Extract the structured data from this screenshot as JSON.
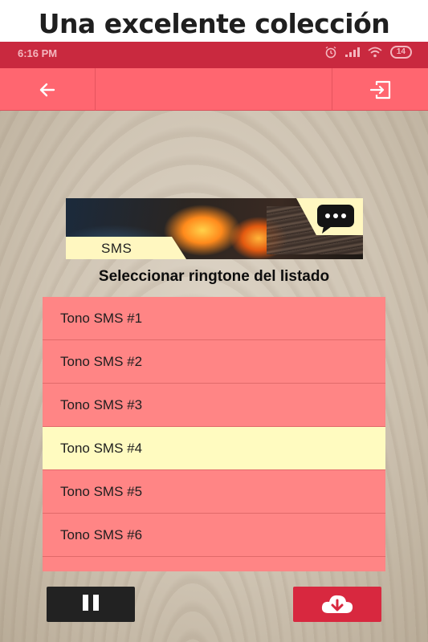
{
  "promo_title": "Una excelente colección",
  "status_bar": {
    "time": "6:16 PM",
    "battery": "14",
    "icons": [
      "alarm-icon",
      "signal-icon",
      "wifi-icon",
      "battery-icon"
    ]
  },
  "app_bar": {
    "back_icon": "arrow-left-icon",
    "exit_icon": "exit-icon"
  },
  "banner": {
    "label": "SMS",
    "icon": "chat-bubble-icon"
  },
  "heading": "Seleccionar ringtone del listado",
  "ringtones": [
    {
      "label": "Tono SMS #1"
    },
    {
      "label": "Tono SMS #2"
    },
    {
      "label": "Tono SMS #3"
    },
    {
      "label": "Tono SMS #4"
    },
    {
      "label": "Tono SMS #5"
    },
    {
      "label": "Tono SMS #6"
    }
  ],
  "selected_ringtone": "Tono SMS #4",
  "controls": {
    "pause_icon": "pause-icon",
    "download_icon": "cloud-download-icon"
  },
  "colors": {
    "status_bar": "#c9293f",
    "app_bar": "#ff6670",
    "list_item": "#ff8585",
    "list_item_selected": "#fffbc0",
    "pause_button": "#222222",
    "download_button": "#d8283f"
  }
}
